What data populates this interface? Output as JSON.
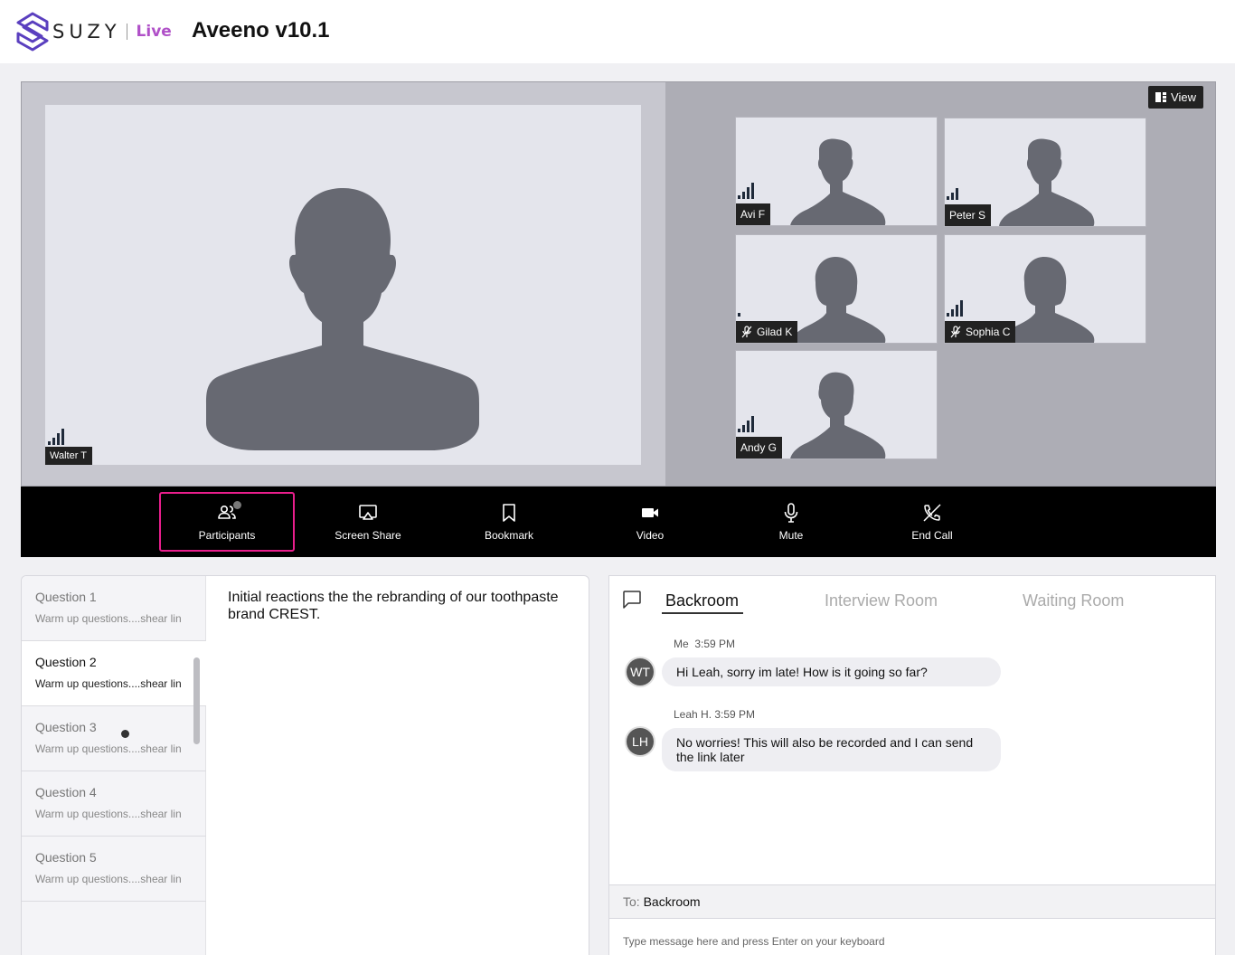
{
  "header": {
    "brand_word": "SUZY",
    "brand_live": "Live",
    "title": "Aveeno v10.1"
  },
  "stage": {
    "view_label": "View",
    "main_participant": {
      "name": "Walter T"
    },
    "participants": [
      {
        "name": "Avi F",
        "muted": false,
        "signal": 3
      },
      {
        "name": "Peter S",
        "muted": false,
        "signal": 2
      },
      {
        "name": "Gilad K",
        "muted": true,
        "signal": 1
      },
      {
        "name": "Sophia C",
        "muted": true,
        "signal": 4
      },
      {
        "name": "Andy G",
        "muted": false,
        "signal": 4
      }
    ]
  },
  "toolbar": {
    "participants": "Participants",
    "screen_share": "Screen Share",
    "bookmark": "Bookmark",
    "video": "Video",
    "mute": "Mute",
    "end_call": "End Call"
  },
  "questions": {
    "items": [
      {
        "title": "Question 1",
        "subtitle": "Warm up questions....shear lin"
      },
      {
        "title": "Question 2",
        "subtitle": "Warm up questions....shear lin"
      },
      {
        "title": "Question 3",
        "subtitle": "Warm up questions....shear lin"
      },
      {
        "title": "Question 4",
        "subtitle": "Warm up questions....shear lin"
      },
      {
        "title": "Question 5",
        "subtitle": "Warm up questions....shear lin"
      }
    ],
    "selected_text": "Initial reactions the the rebranding of our toothpaste brand CREST."
  },
  "chat": {
    "tabs": [
      "Backroom",
      "Interview Room",
      "Waiting Room"
    ],
    "messages": [
      {
        "meta": "Me  3:59 PM",
        "initials": "WT",
        "text": "Hi Leah, sorry im late! How is it going so far?"
      },
      {
        "meta": "Leah H. 3:59 PM",
        "initials": "LH",
        "text": "No worries! This will also be recorded and I can send the link later"
      }
    ],
    "to_label": "To:",
    "to_value": "Backroom",
    "input_placeholder": "Type message here and press Enter on your keyboard"
  },
  "colors": {
    "brand_purple": "#5a3fbf",
    "live_pink": "#b050c8",
    "active_tool_border": "#e91e8c"
  }
}
